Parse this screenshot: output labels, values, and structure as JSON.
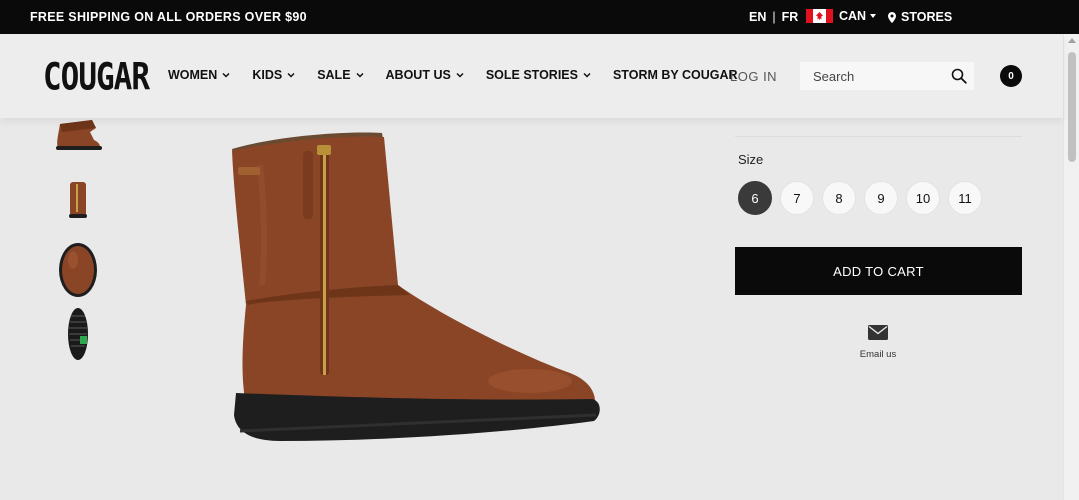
{
  "topbar": {
    "promo": "FREE SHIPPING ON ALL ORDERS OVER $90",
    "lang_en": "EN",
    "lang_sep": "|",
    "lang_fr": "FR",
    "country": "CAN",
    "stores": "STORES"
  },
  "header": {
    "logo": "COUGAR",
    "nav": [
      "WOMEN",
      "KIDS",
      "SALE",
      "ABOUT US",
      "SOLE STORIES",
      "STORM BY COUGAR"
    ],
    "login": "LOG IN",
    "search_placeholder": "Search",
    "cart_count": "0"
  },
  "product": {
    "size_label": "Size",
    "sizes": [
      "6",
      "7",
      "8",
      "9",
      "10",
      "11"
    ],
    "selected_size": "6",
    "add_to_cart": "ADD TO CART",
    "email_label": "Email us"
  },
  "colors": {
    "accent": "#0a0a0a",
    "boot_leather": "#8a4526",
    "sole": "#1e1e1e",
    "zipper": "#c8a04a"
  },
  "icons": [
    "flag-canada-icon",
    "map-pin-icon",
    "chevron-down-icon",
    "search-icon",
    "cart-count-badge",
    "envelope-icon"
  ]
}
